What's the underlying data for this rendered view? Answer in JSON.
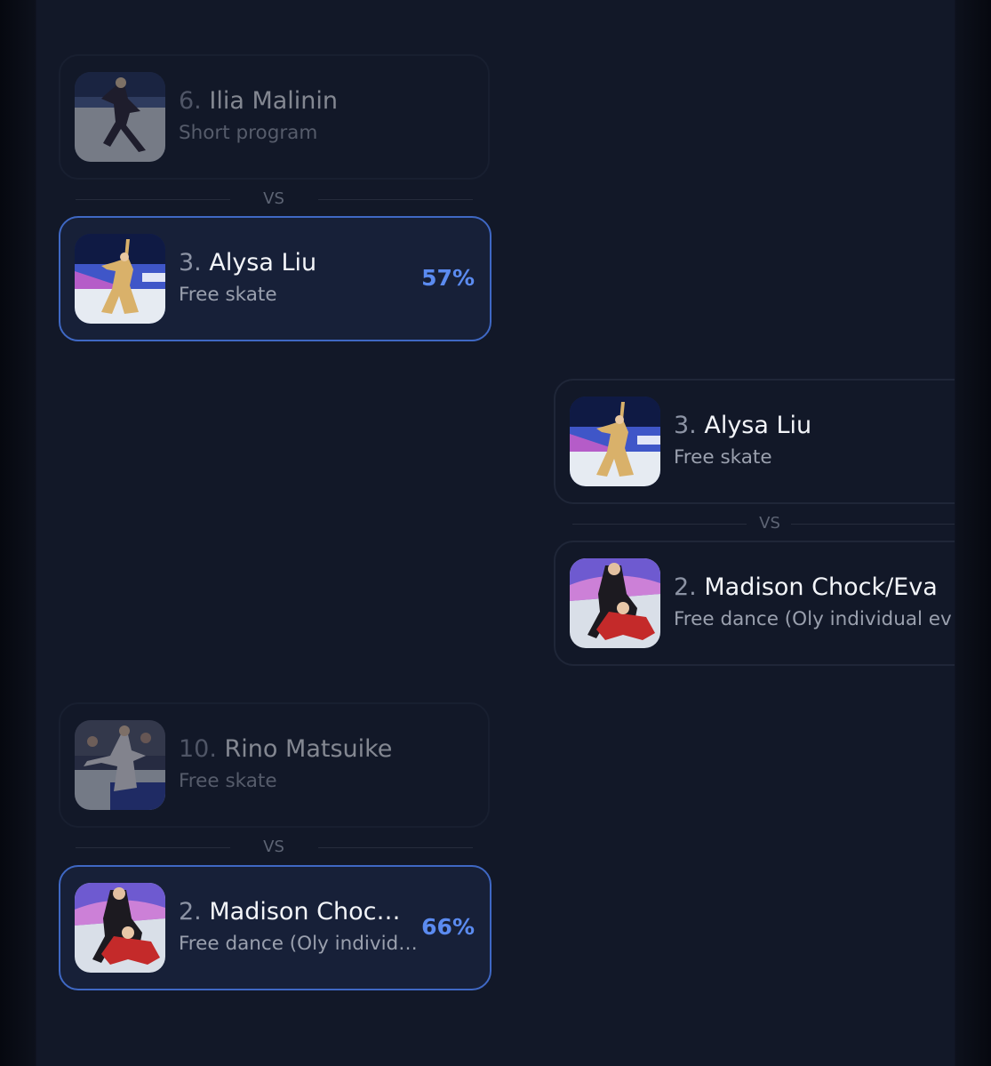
{
  "matchups": [
    {
      "top": {
        "seed": "6.",
        "name": "Ilia Malinin",
        "event": "Short program",
        "thumb": "malinin-photo"
      },
      "vs": "VS",
      "bottom": {
        "seed": "3.",
        "name": "Alysa Liu",
        "event": "Free skate",
        "pct": "57%",
        "thumb": "liu-photo"
      }
    },
    {
      "top": {
        "seed": "3.",
        "name": "Alysa Liu",
        "event": "Free skate",
        "thumb": "liu-photo"
      },
      "vs": "VS",
      "bottom": {
        "seed": "2.",
        "name": "Madison Chock/Eva",
        "event": "Free dance (Oly individual ev",
        "thumb": "chock-bates-photo"
      }
    },
    {
      "top": {
        "seed": "10.",
        "name": "Rino Matsuike",
        "event": "Free skate",
        "thumb": "matsuike-photo"
      },
      "vs": "VS",
      "bottom": {
        "seed": "2.",
        "name": "Madison Choc…",
        "event": "Free dance (Oly individ…",
        "pct": "66%",
        "thumb": "chock-bates-photo"
      }
    }
  ],
  "colors": {
    "background": "#121828",
    "winner_border": "#3f68c4",
    "winner_fill": "#172038",
    "percent": "#5b8bf0"
  }
}
